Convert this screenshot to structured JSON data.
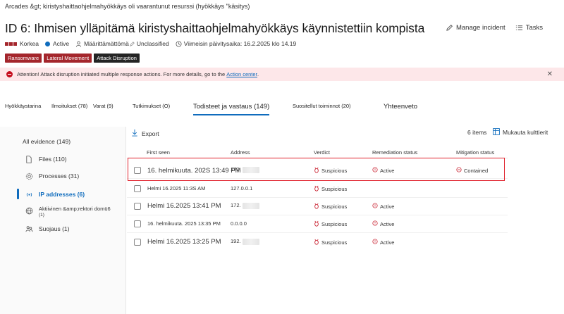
{
  "breadcrumb": "Arcades &gt; kiristyshaittaohjelmahyökkäys oli vaarantunut resurssi (hyökkäys \"käsitys)",
  "title": "ID 6: Ihmisen ylläpitämä kiristyshaittaohjelmahyökkäys käynnistettiin kompista",
  "top_actions": {
    "manage": "Manage incident",
    "tasks": "Tasks"
  },
  "meta": {
    "severity": "Korkea",
    "status": "Active",
    "assigned": "Määrittämättömä",
    "classification": "Unclassified",
    "updated": "Viimeisin päivitysaika: 16.2.2025 klo 14.19"
  },
  "tags": [
    "Ransomware",
    "Lateral Movement",
    "Attack Disruption"
  ],
  "banner": {
    "text": "Attention! Attack disruption initiated multiple response actions. For more details, go to the",
    "link": "Action center",
    "end": "."
  },
  "tabs": [
    "Hyökkäystarina",
    "Ilmoitukset (78)",
    "Varat (9)",
    "Tutkimukset (O)",
    "Todisteet ja vastaus (149)",
    "Suositellut toiminnot (20)",
    "Yhteenveto"
  ],
  "sidebar": {
    "all": "All evidence (149)",
    "items": [
      {
        "label": "Files (110)",
        "icon": "file-icon"
      },
      {
        "label": "Processes (31)",
        "icon": "gear-icon"
      },
      {
        "label": "IP addresses (6)",
        "icon": "broadcast-icon"
      },
      {
        "label": "Aktiivinen &amp;rektori domü6",
        "sub": "(1)",
        "icon": "globe-icon"
      },
      {
        "label": "Suojaus (1)",
        "icon": "users-icon"
      }
    ]
  },
  "toolbar": {
    "export": "Export",
    "count": "6 items",
    "customize": "Mukauta kulttierit"
  },
  "table": {
    "columns": [
      "First seen",
      "Address",
      "Verdict",
      "Remediation status",
      "Mitigation status"
    ],
    "rows": [
      {
        "first_seen": "16. helmikuuta. 202S 13:49 PM",
        "address": "172.",
        "verdict": "Suspicious",
        "remediation": "Active",
        "mitigation": "Contained"
      },
      {
        "first_seen": "Helmi 16.2025 11:3S AM",
        "address": "127.0.0.1",
        "verdict": "Suspicious",
        "remediation": "",
        "mitigation": ""
      },
      {
        "first_seen": "Helmi 16.2025 13:41 PM",
        "address": "172.",
        "verdict": "Suspicious",
        "remediation": "Active",
        "mitigation": ""
      },
      {
        "first_seen": "16. helmikuuta. 2025 13:35 PM",
        "address": "0.0.0.0",
        "verdict": "Suspicious",
        "remediation": "Active",
        "mitigation": ""
      },
      {
        "first_seen": "Helmi 16.2025 13:25 PM",
        "address": "192.",
        "verdict": "Suspicious",
        "remediation": "Active",
        "mitigation": ""
      }
    ]
  },
  "colors": {
    "accent": "#0f6cbd",
    "danger": "#a4262c",
    "banner_bg": "#fde7e9",
    "highlight": "#e0202b"
  }
}
